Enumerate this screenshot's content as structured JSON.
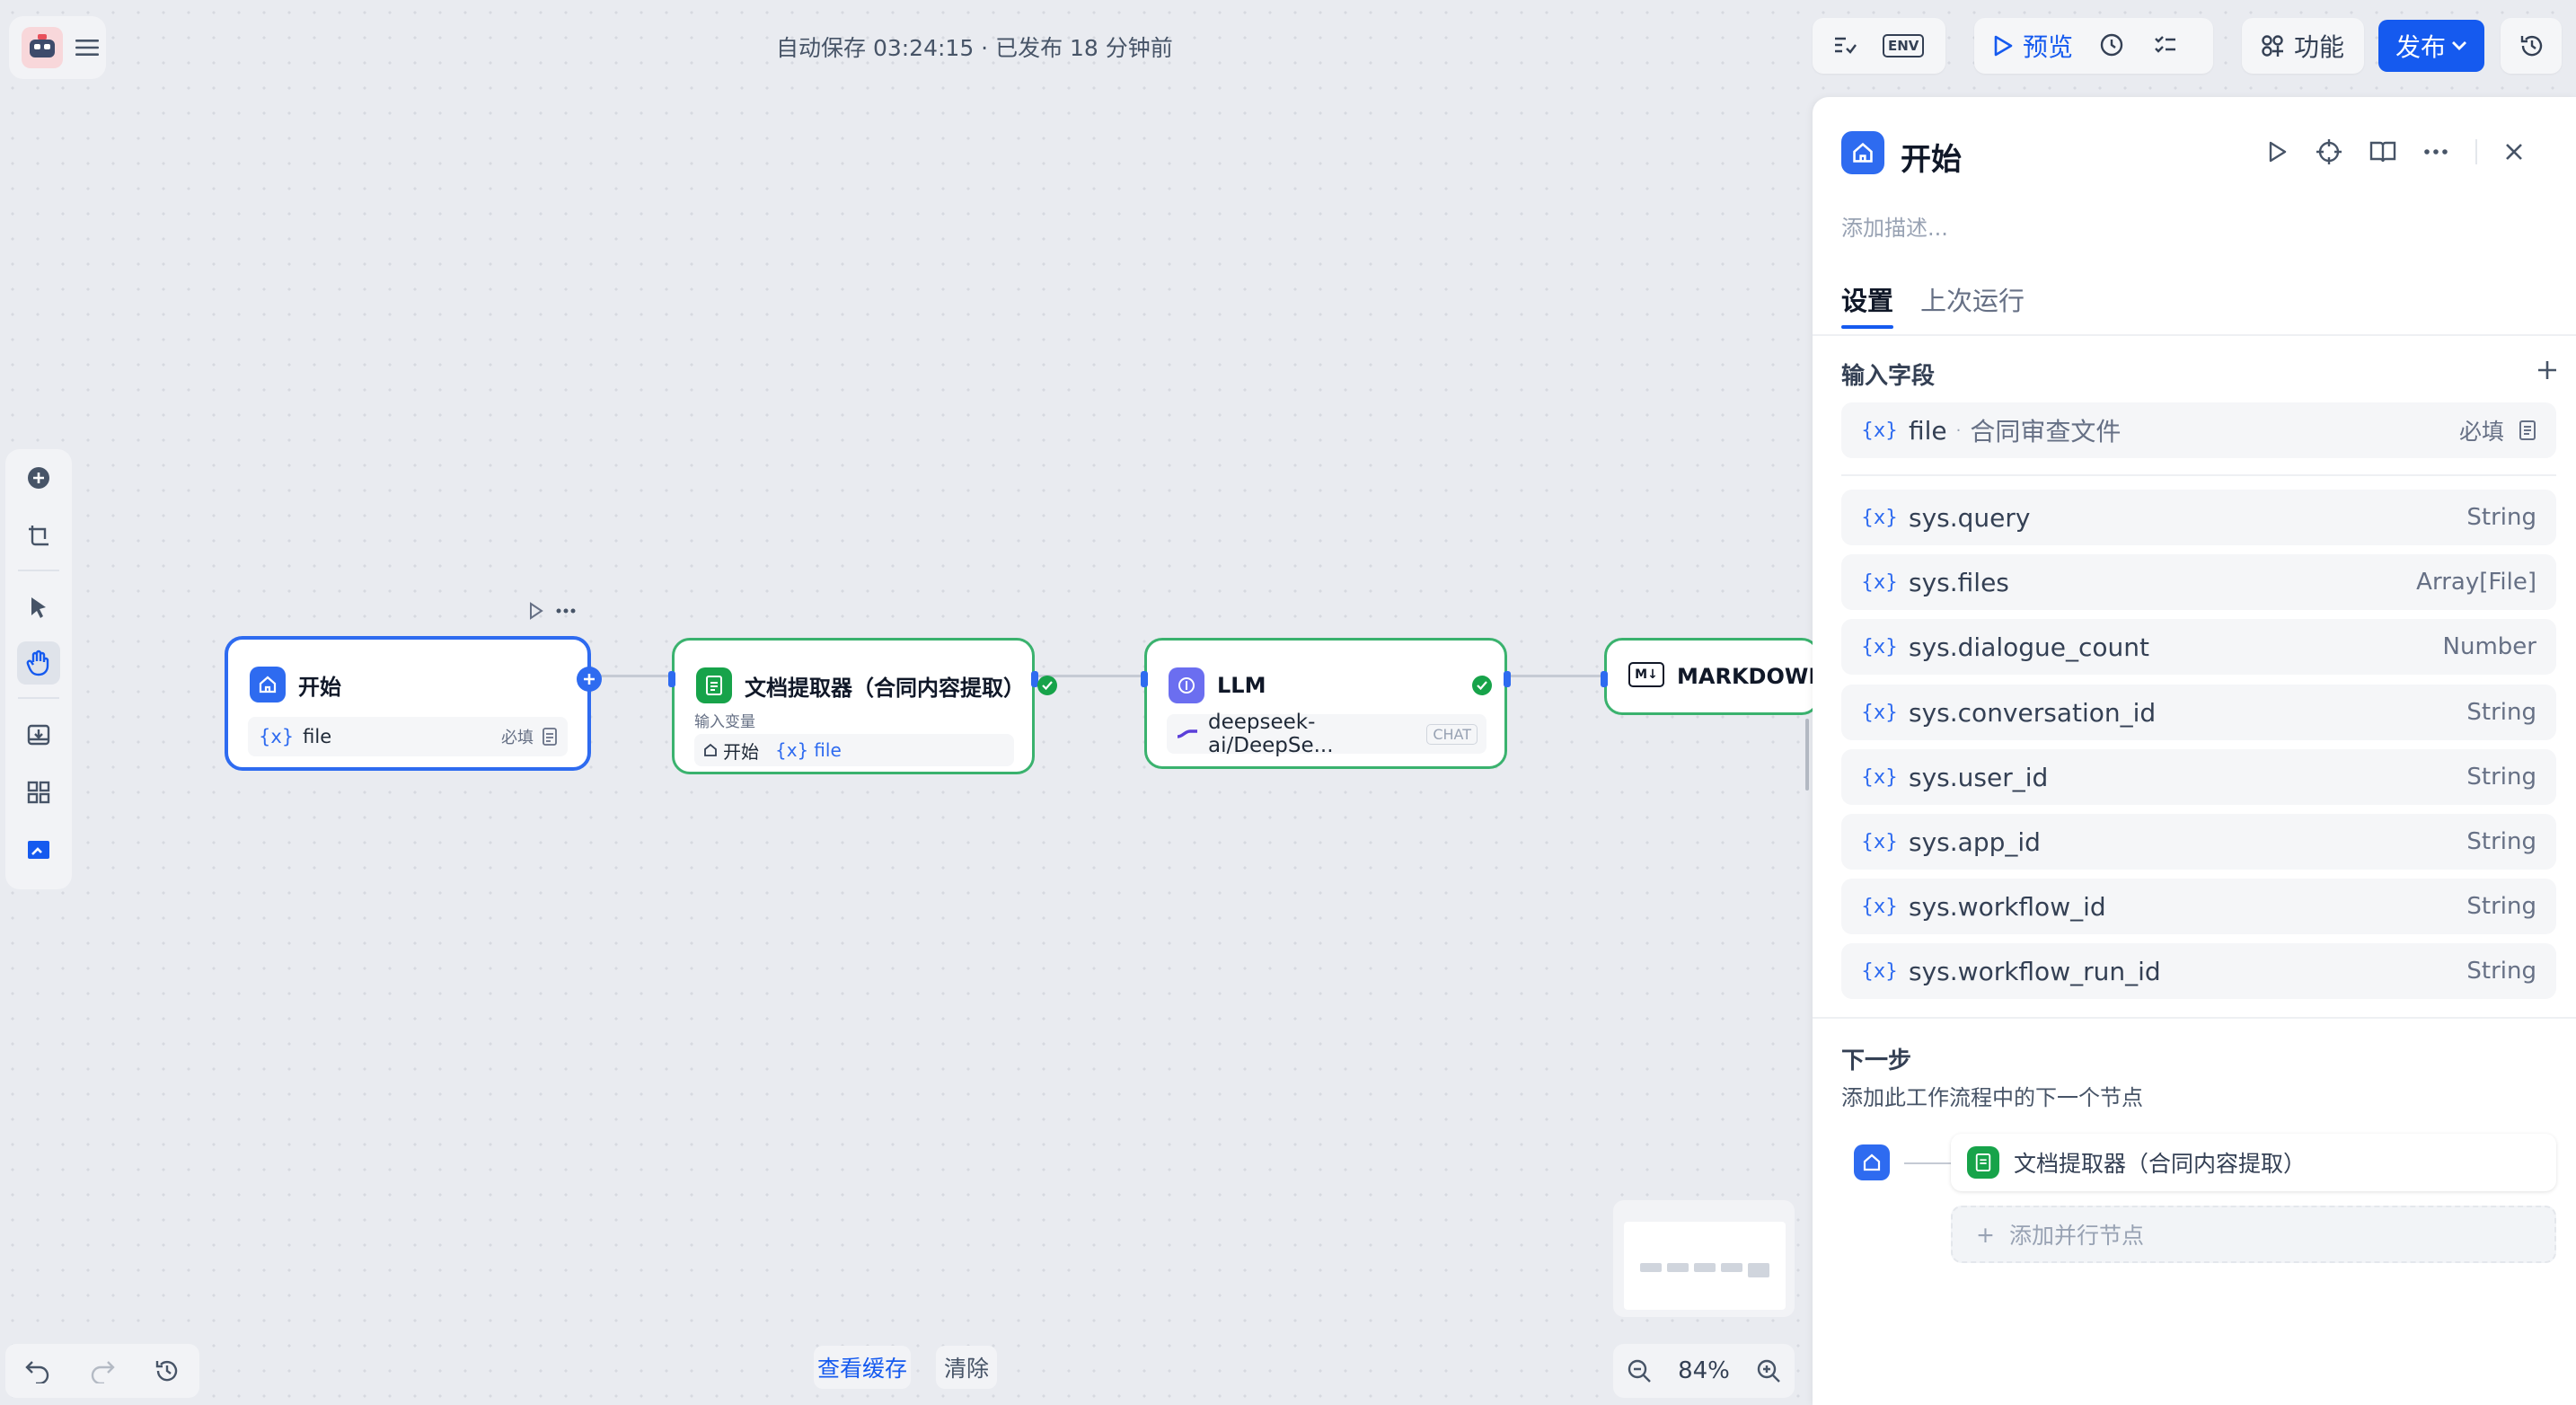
{
  "header": {
    "autosave": "自动保存 03:24:15 · 已发布 18 分钟前",
    "env_label": "ENV",
    "preview_label": "预览",
    "features_label": "功能",
    "publish_label": "发布"
  },
  "canvas": {
    "nodes": {
      "start": {
        "title": "开始",
        "var": "file",
        "required": "必填"
      },
      "doc": {
        "title": "文档提取器（合同内容提取）",
        "input_label": "输入变量",
        "src": "开始",
        "var": "file"
      },
      "llm": {
        "title": "LLM",
        "model": "deepseek-ai/DeepSe...",
        "mode": "CHAT"
      },
      "md": {
        "title": "MARKDOWN转"
      }
    },
    "view_cache": "查看缓存",
    "clear": "清除",
    "zoom": "84%"
  },
  "panel": {
    "title": "开始",
    "desc_placeholder": "添加描述...",
    "tabs": [
      "设置",
      "上次运行"
    ],
    "input_fields_title": "输入字段",
    "file_field": {
      "name": "file",
      "label": "合同审查文件",
      "required": "必填"
    },
    "sys_vars": [
      {
        "name": "sys.query",
        "type": "String"
      },
      {
        "name": "sys.files",
        "type": "Array[File]"
      },
      {
        "name": "sys.dialogue_count",
        "type": "Number"
      },
      {
        "name": "sys.conversation_id",
        "type": "String"
      },
      {
        "name": "sys.user_id",
        "type": "String"
      },
      {
        "name": "sys.app_id",
        "type": "String"
      },
      {
        "name": "sys.workflow_id",
        "type": "String"
      },
      {
        "name": "sys.workflow_run_id",
        "type": "String"
      }
    ],
    "next_step": {
      "title": "下一步",
      "desc": "添加此工作流程中的下一个节点",
      "next_node": "文档提取器（合同内容提取）",
      "add_parallel": "添加并行节点"
    }
  },
  "colors": {
    "accent": "#155aef",
    "success": "#17a34a",
    "node_border": "#3ab26e"
  }
}
